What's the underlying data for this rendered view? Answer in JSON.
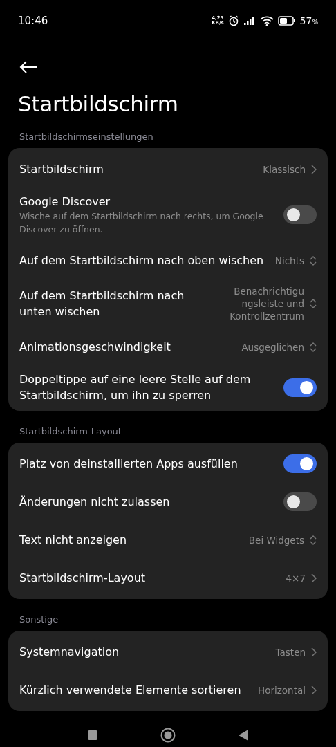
{
  "status_bar": {
    "time": "10:46",
    "speed_value": "4,25",
    "speed_unit": "KB/s",
    "battery": "57",
    "battery_unit": "%"
  },
  "header": {
    "title": "Startbildschirm"
  },
  "sections": [
    {
      "label": "Startbildschirmseinstellungen",
      "rows": [
        {
          "kind": "link",
          "title": "Startbildschirm",
          "value": "Klassisch"
        },
        {
          "kind": "toggle",
          "title": "Google Discover",
          "subtitle": "Wische auf dem Startbildschirm nach rechts, um Google Discover zu öffnen.",
          "on": false
        },
        {
          "kind": "select",
          "title": "Auf dem Startbildschirm nach oben wischen",
          "value": "Nichts"
        },
        {
          "kind": "select",
          "title": "Auf dem Startbildschirm nach unten wischen",
          "value": "Benachrichtigu ngsleiste und Kontrollzentrum"
        },
        {
          "kind": "select",
          "title": "Animationsgeschwindigkeit",
          "value": "Ausgeglichen"
        },
        {
          "kind": "toggle",
          "title": "Doppeltippe auf eine leere Stelle auf dem Startbildschirm, um ihn zu sperren",
          "on": true
        }
      ]
    },
    {
      "label": "Startbildschirm-Layout",
      "rows": [
        {
          "kind": "toggle",
          "title": "Platz von deinstallierten Apps ausfüllen",
          "on": true
        },
        {
          "kind": "toggle",
          "title": "Änderungen nicht zulassen",
          "on": false
        },
        {
          "kind": "select",
          "title": "Text nicht anzeigen",
          "value": "Bei Widgets"
        },
        {
          "kind": "link",
          "title": "Startbildschirm-Layout",
          "value": "4×7"
        }
      ]
    },
    {
      "label": "Sonstige",
      "rows": [
        {
          "kind": "link",
          "title": "Systemnavigation",
          "value": "Tasten"
        },
        {
          "kind": "link",
          "title": "Kürzlich verwendete Elemente sortieren",
          "value": "Horizontal"
        }
      ]
    }
  ]
}
